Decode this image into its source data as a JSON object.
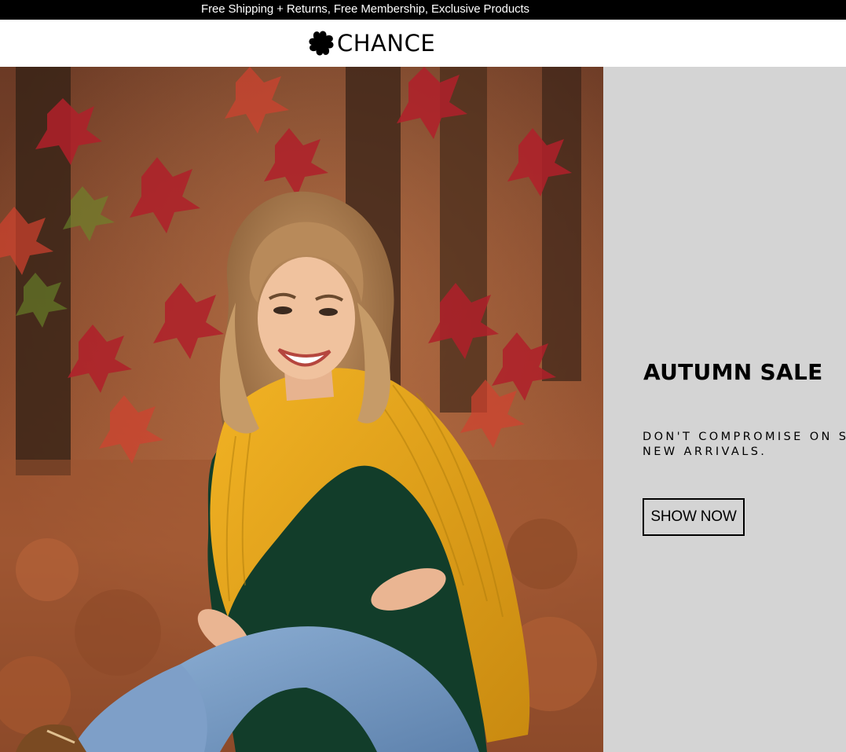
{
  "announcement": {
    "text": "Free Shipping + Returns, Free Membership, Exclusive Products"
  },
  "header": {
    "logo_text": "CHANCE",
    "logo_icon": "clover-icon"
  },
  "hero": {
    "image_alt": "woman-in-autumn-sweater-photo",
    "title": "AUTUMN SALE",
    "subtitle": "DON'T COMPROMISE ON ST NEW ARRIVALS.",
    "subtitle_line1": "DON'T COMPROMISE ON ST",
    "subtitle_line2": "NEW ARRIVALS.",
    "button_label": "SHOW NOW",
    "panel_color": "#d4d4d4"
  },
  "colors": {
    "announcement_bg": "#000000",
    "announcement_text": "#ffffff",
    "header_bg": "#ffffff",
    "text_primary": "#000000"
  }
}
